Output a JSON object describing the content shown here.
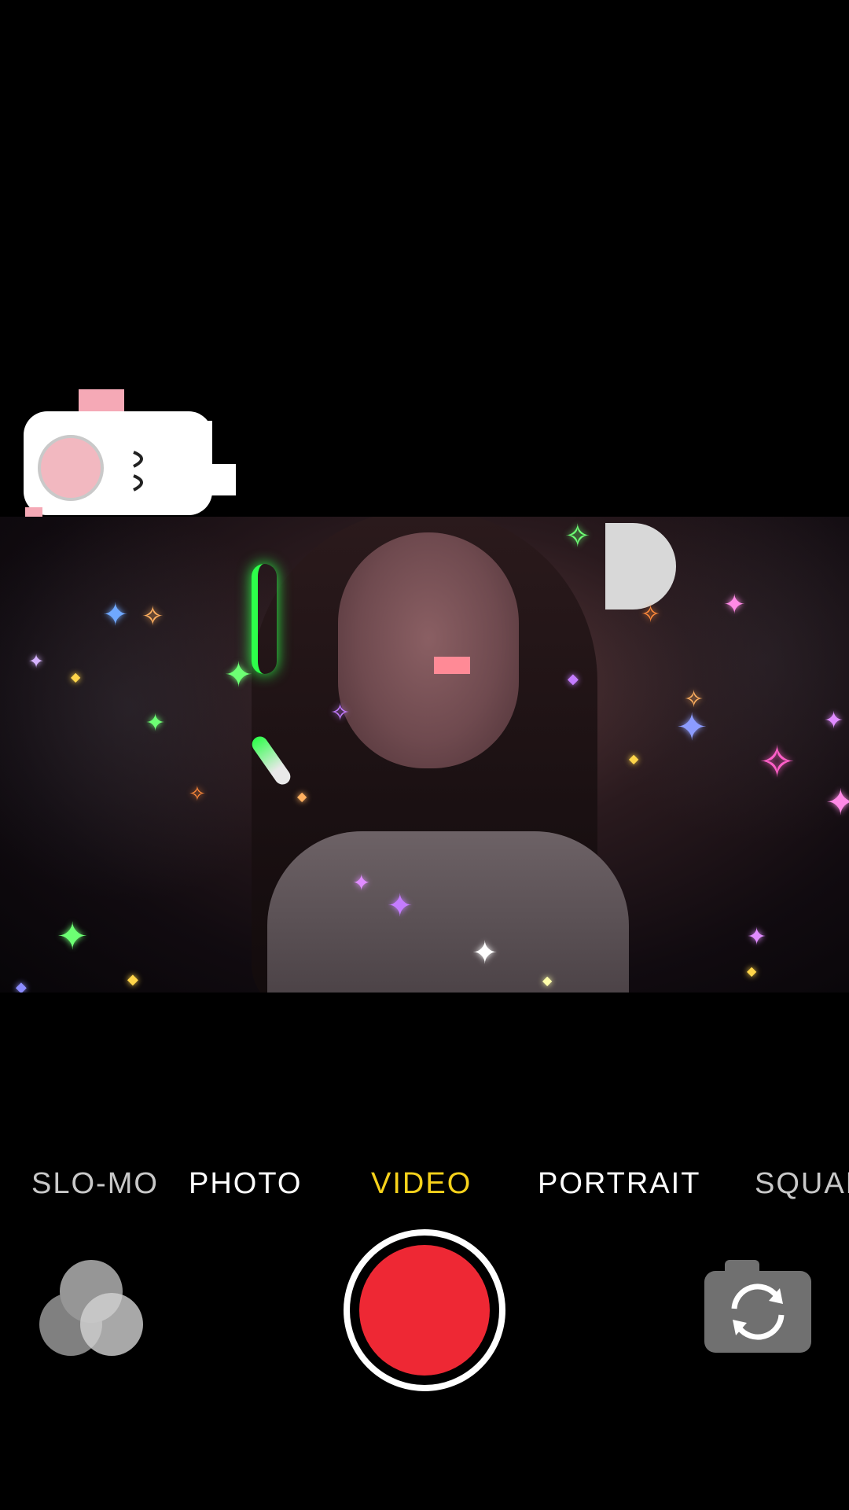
{
  "camera": {
    "modes": [
      {
        "label": "SLO-MO",
        "state": "dim"
      },
      {
        "label": "PHOTO",
        "state": "normal"
      },
      {
        "label": "VIDEO",
        "state": "active"
      },
      {
        "label": "PORTRAIT",
        "state": "normal"
      },
      {
        "label": "SQUARE",
        "state": "clipped"
      }
    ],
    "selected_mode": "VIDEO",
    "shutter": {
      "icon": "record-icon",
      "color": "#ee2834"
    },
    "filters_button": {
      "icon": "filters-icon"
    },
    "flip_button": {
      "icon": "camera-flip-icon"
    }
  },
  "overlay": {
    "sticker": "pixel-cat-sticker",
    "effect": "sparkle-filter"
  },
  "colors": {
    "active_mode": "#f7d21b",
    "record": "#ee2834",
    "background": "#000000"
  }
}
